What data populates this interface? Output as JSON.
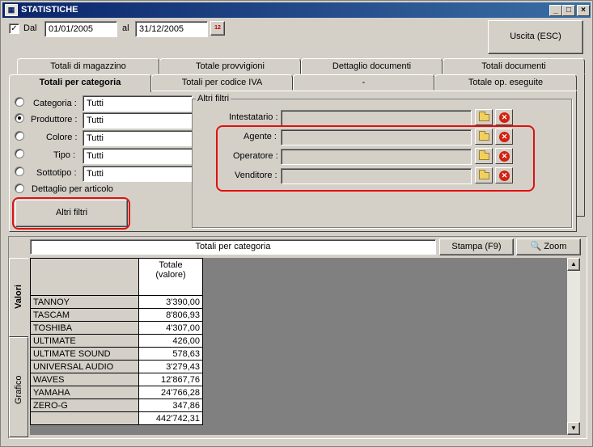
{
  "window": {
    "title": "STATISTICHE",
    "app_icon": "chart-icon",
    "controls": {
      "minimize": "_",
      "maximize": "□",
      "close": "×"
    }
  },
  "date_filter": {
    "enabled": true,
    "from_label": "Dal",
    "from_value": "01/01/2005",
    "to_label": "al",
    "to_value": "31/12/2005",
    "calendar_icon": "calendar-icon",
    "calendar_text": "12"
  },
  "exit_button": "Uscita (ESC)",
  "tabs_row1": [
    "Totali di magazzino",
    "Totale provvigioni",
    "Dettaglio documenti",
    "Totali documenti"
  ],
  "tabs_row2": [
    "Totali per categoria",
    "Totali per codice IVA",
    "-",
    "Totale op. eseguite"
  ],
  "active_tab": "Totali per categoria",
  "category_filters": [
    {
      "label": "Categoria :",
      "value": "Tutti",
      "selected": false
    },
    {
      "label": "Produttore :",
      "value": "Tutti",
      "selected": true
    },
    {
      "label": "Colore :",
      "value": "Tutti",
      "selected": false
    },
    {
      "label": "Tipo :",
      "value": "Tutti",
      "selected": false
    },
    {
      "label": "Sottotipo :",
      "value": "Tutti",
      "selected": false
    }
  ],
  "detail_by_article_label": "Dettaglio per articolo",
  "other_filters_button": "Altri filtri",
  "other_filters_group": {
    "title": "Altri filtri",
    "rows": [
      {
        "label": "Intestatario :",
        "value": ""
      },
      {
        "label": "Agente :",
        "value": ""
      },
      {
        "label": "Operatore :",
        "value": ""
      },
      {
        "label": "Venditore :",
        "value": ""
      }
    ]
  },
  "results": {
    "title": "Totali per categoria",
    "print_button": "Stampa (F9)",
    "zoom_button": "Zoom",
    "side_tabs": [
      "Valori",
      "Grafico"
    ],
    "column_header": "Totale\n(valore)",
    "rows": [
      {
        "name": "TANNOY",
        "value": "3'390,00"
      },
      {
        "name": "TASCAM",
        "value": "8'806,93"
      },
      {
        "name": "TOSHIBA",
        "value": "4'307,00"
      },
      {
        "name": "ULTIMATE",
        "value": "426,00"
      },
      {
        "name": "ULTIMATE SOUND",
        "value": "578,63"
      },
      {
        "name": "UNIVERSAL AUDIO",
        "value": "3'279,43"
      },
      {
        "name": "WAVES",
        "value": "12'867,76"
      },
      {
        "name": "YAMAHA",
        "value": "24'766,28"
      },
      {
        "name": "ZERO-G",
        "value": "347,86"
      }
    ],
    "total": "442'742,31"
  }
}
